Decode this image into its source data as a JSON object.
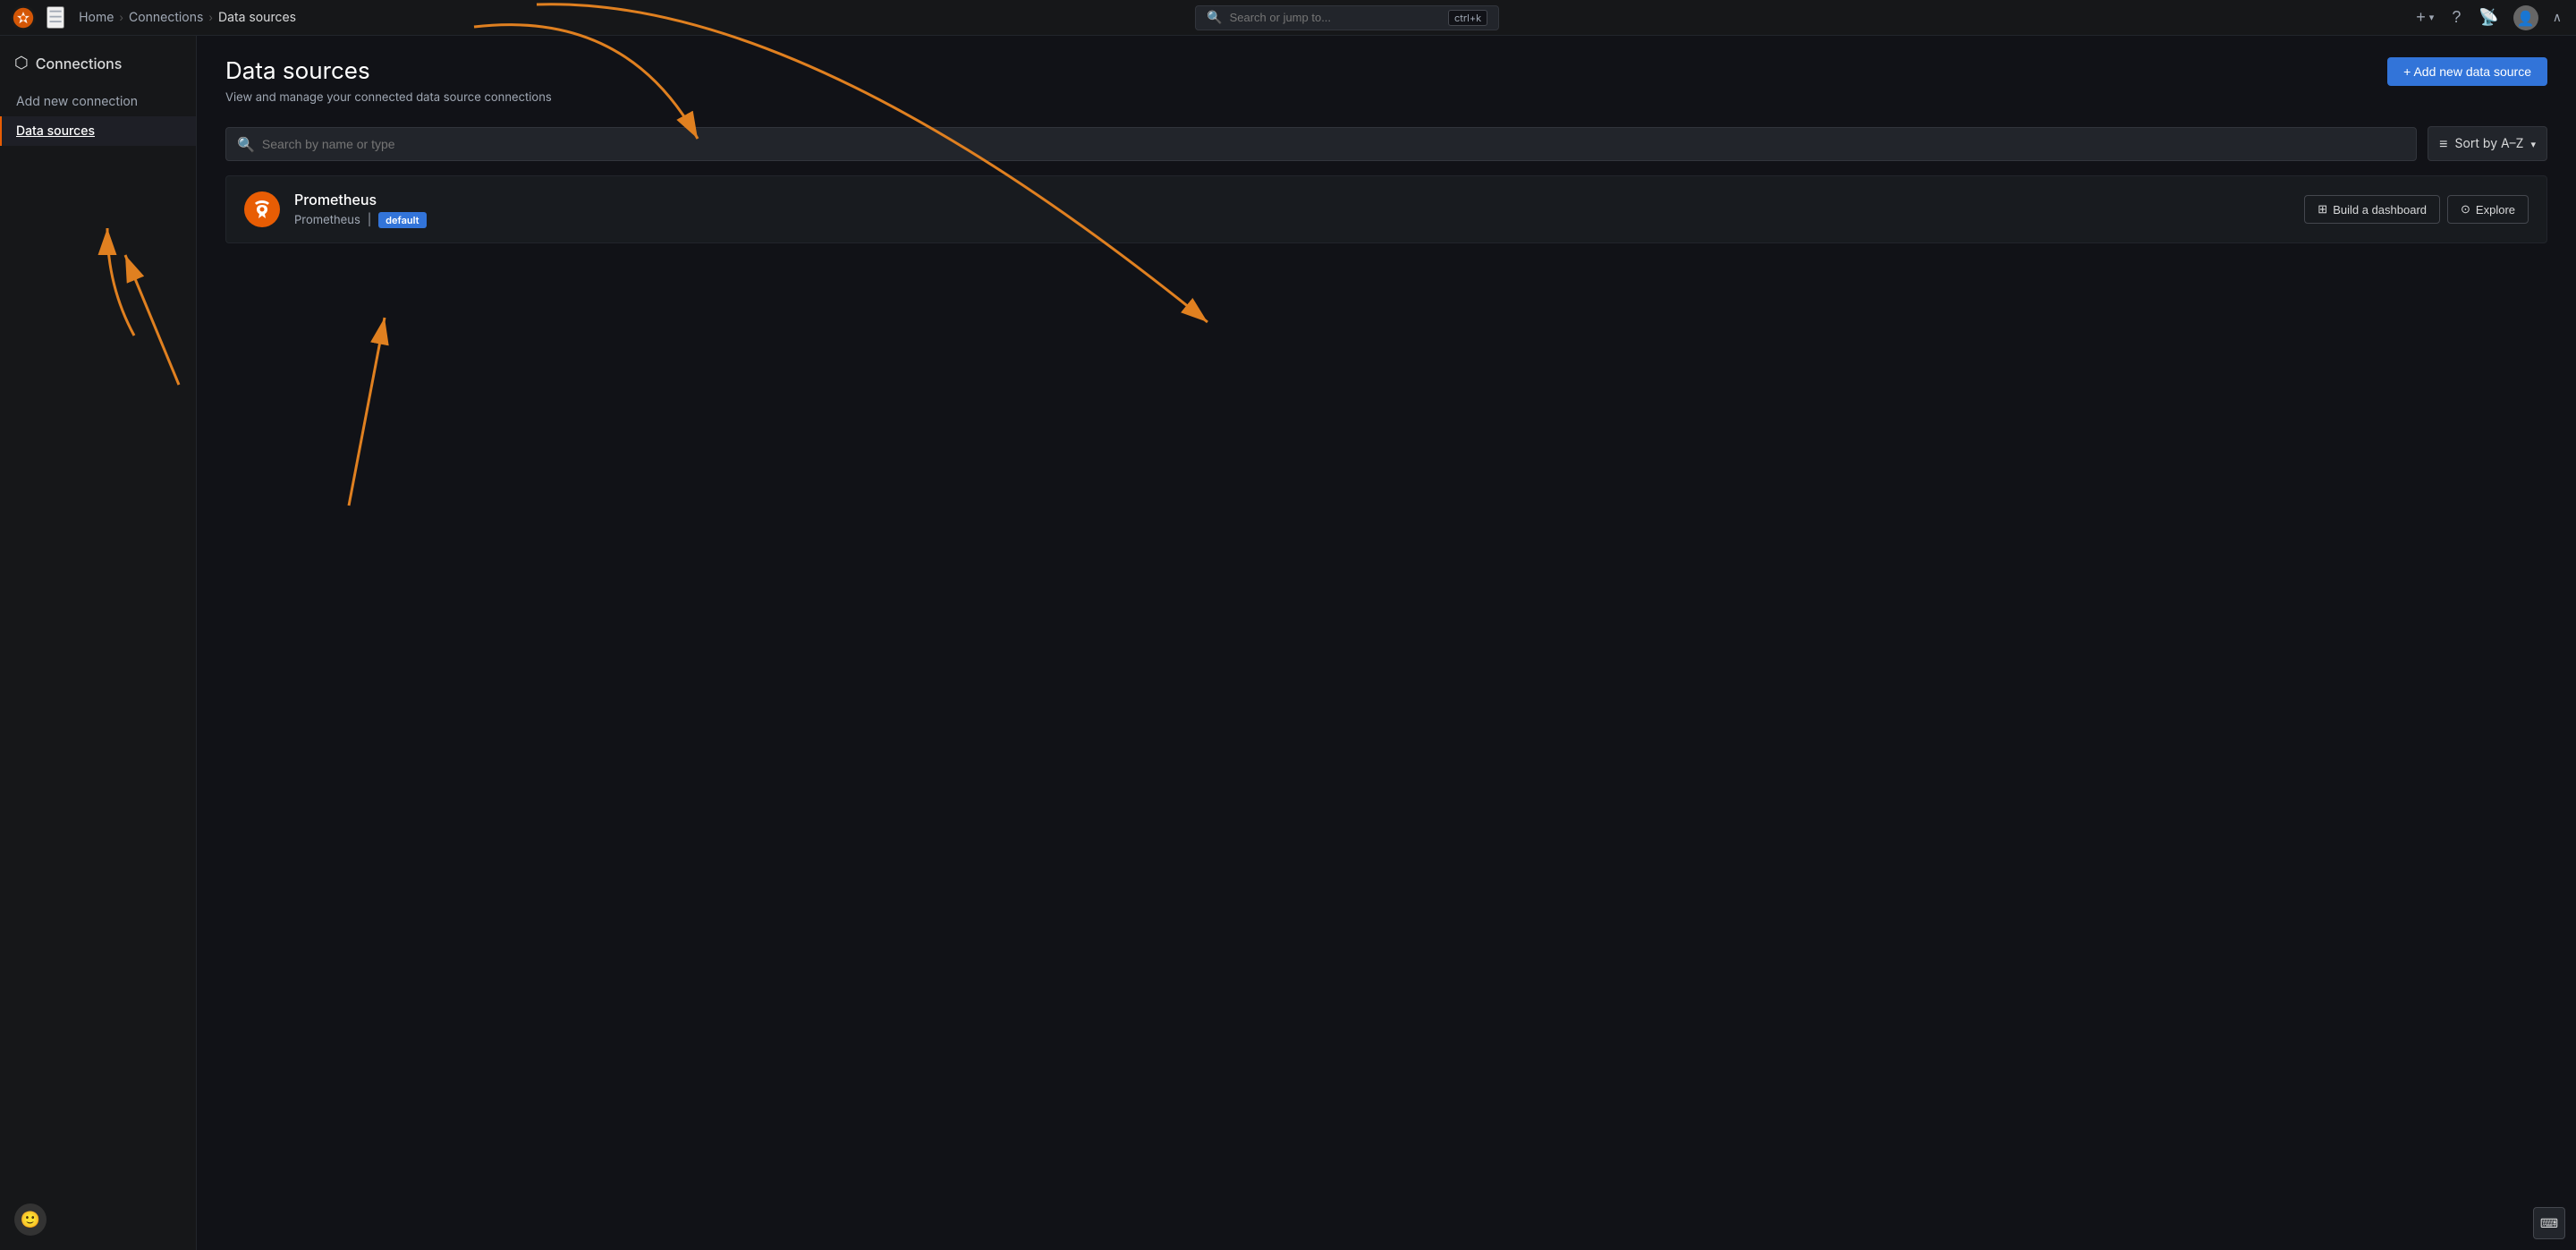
{
  "topnav": {
    "search_placeholder": "Search or jump to...",
    "search_shortcut": "ctrl+k",
    "breadcrumb": {
      "home": "Home",
      "connections": "Connections",
      "current": "Data sources"
    }
  },
  "sidebar": {
    "title": "Connections",
    "items": [
      {
        "id": "add-new-connection",
        "label": "Add new connection",
        "active": false
      },
      {
        "id": "data-sources",
        "label": "Data sources",
        "active": true
      }
    ]
  },
  "main": {
    "title": "Data sources",
    "subtitle": "View and manage your connected data source connections",
    "add_button_label": "+ Add new data source",
    "search_placeholder": "Search by name or type",
    "sort_label": "Sort by A–Z",
    "datasources": [
      {
        "name": "Prometheus",
        "type": "Prometheus",
        "badge": "default",
        "icon_text": "🔥"
      }
    ]
  },
  "actions": {
    "build_dashboard": "Build a dashboard",
    "explore": "Explore"
  },
  "icons": {
    "connections": "⬡",
    "search": "🔍",
    "sort": "≡",
    "grid": "⊞",
    "compass": "⊙",
    "plus": "+",
    "question": "?",
    "rss": "◎",
    "chevron_up": "∧",
    "chevron_down": "∨",
    "terminal": "⌨",
    "hamburger": "☰"
  }
}
